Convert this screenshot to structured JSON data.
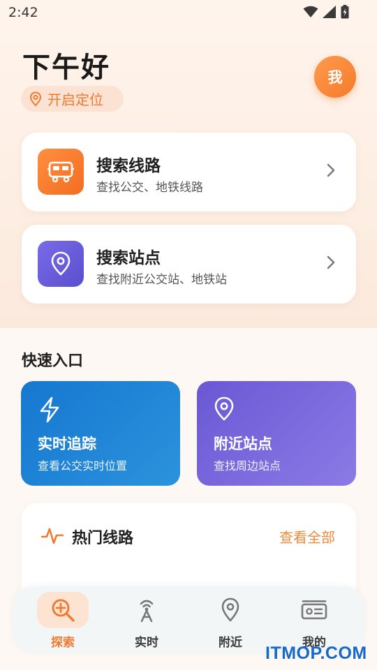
{
  "status_bar": {
    "time": "2:42"
  },
  "header": {
    "greeting": "下午好",
    "locate_label": "开启定位",
    "avatar_text": "我"
  },
  "cards": [
    {
      "title": "搜索线路",
      "subtitle": "查找公交、地铁线路",
      "icon": "bus-icon",
      "color": "#f57c2b"
    },
    {
      "title": "搜索站点",
      "subtitle": "查找附近公交站、地铁站",
      "icon": "location-pin-icon",
      "color": "#6a5fd8"
    }
  ],
  "quick_section": {
    "title": "快速入口",
    "items": [
      {
        "title": "实时追踪",
        "subtitle": "查看公交实时位置",
        "icon": "lightning-icon",
        "color": "#1f7ed4"
      },
      {
        "title": "附近站点",
        "subtitle": "查找周边站点",
        "icon": "location-pin-icon",
        "color": "#6a5fd8"
      }
    ]
  },
  "hot_lines": {
    "title": "热门线路",
    "view_all": "查看全部",
    "icon": "activity-icon"
  },
  "bottom_nav": {
    "items": [
      {
        "label": "探索",
        "icon": "search-plus-icon",
        "active": true
      },
      {
        "label": "实时",
        "icon": "signal-tower-icon",
        "active": false
      },
      {
        "label": "附近",
        "icon": "location-pin-icon",
        "active": false
      },
      {
        "label": "我的",
        "icon": "id-card-icon",
        "active": false
      }
    ]
  },
  "watermark": "ITMOP.COM",
  "colors": {
    "accent": "#f07a2f",
    "purple": "#6a5fd8",
    "blue": "#1f7ed4"
  }
}
